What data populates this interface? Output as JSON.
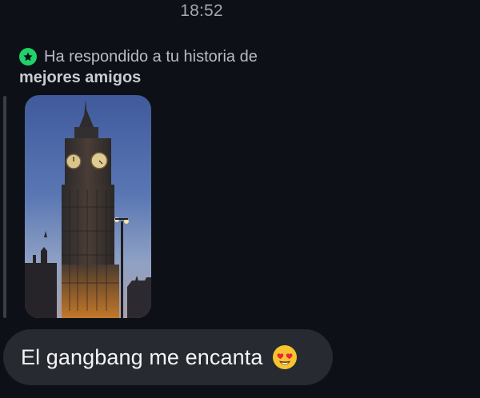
{
  "status": {
    "time": "18:52"
  },
  "reply_header": {
    "text_line1": "Ha respondido a tu historia de",
    "text_line2": "mejores amigos",
    "badge_icon": "star-icon",
    "badge_color": "#1fd26b"
  },
  "story": {
    "image": "big-ben-tower-photo"
  },
  "message": {
    "text": "El gangbang me encanta",
    "emoji": "heart-eyes-emoji"
  }
}
